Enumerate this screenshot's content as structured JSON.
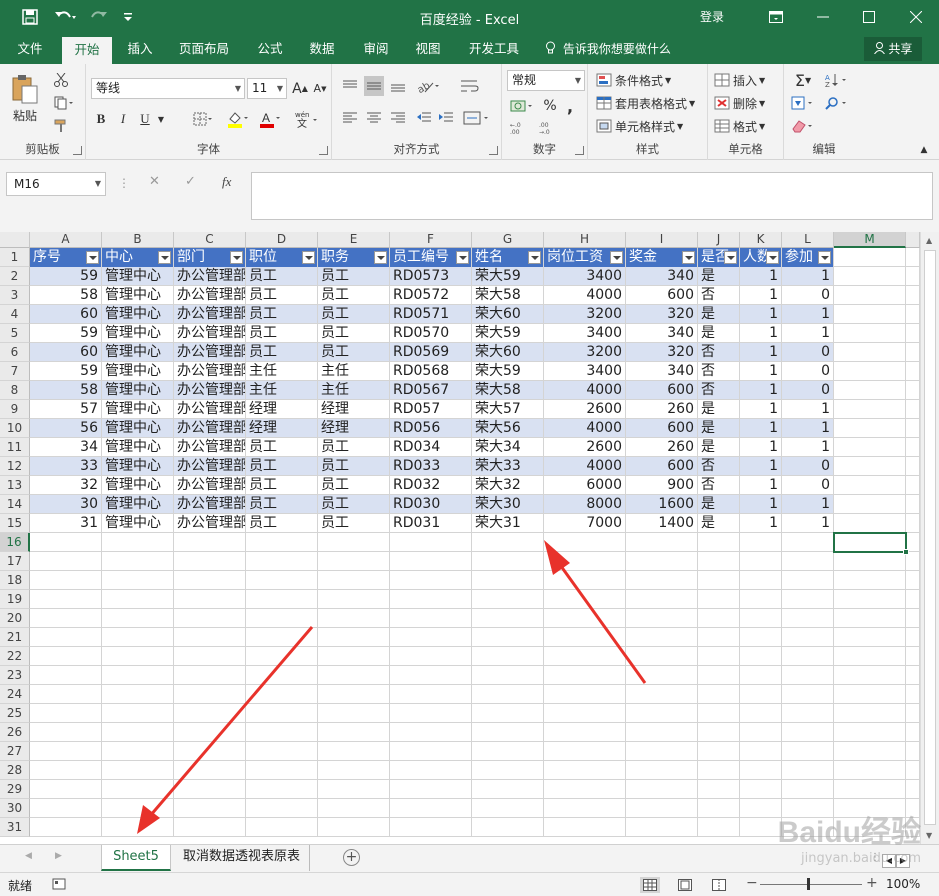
{
  "window": {
    "title": "百度经验 - Excel",
    "login": "登录",
    "accent": "#217346"
  },
  "tabs": [
    "文件",
    "开始",
    "插入",
    "页面布局",
    "公式",
    "数据",
    "审阅",
    "视图",
    "开发工具"
  ],
  "active_tab": "开始",
  "tell_me": "告诉我你想要做什么",
  "share": "共享",
  "ribbon": {
    "paste": "粘贴",
    "clipboard": "剪贴板",
    "font_name": "等线",
    "font_size": "11",
    "font_group": "字体",
    "bold": "B",
    "italic": "I",
    "underline": "U",
    "align_group": "对齐方式",
    "number_format": "常规",
    "number_group": "数字",
    "percent": "%",
    "comma": ",",
    "cond_format": "条件格式",
    "table_format": "套用表格格式",
    "cell_style": "单元格样式",
    "style_group": "样式",
    "insert": "插入",
    "delete": "删除",
    "format": "格式",
    "cells_group": "单元格",
    "edit_group": "编辑"
  },
  "formula_bar": {
    "name_box": "M16",
    "fx": "fx",
    "value": ""
  },
  "columns": [
    "A",
    "B",
    "C",
    "D",
    "E",
    "F",
    "G",
    "H",
    "I",
    "J",
    "K",
    "L",
    "M"
  ],
  "selected_column": "M",
  "table_headers": [
    "序号",
    "中心",
    "部门",
    "职位",
    "职务",
    "员工编号",
    "姓名",
    "岗位工资",
    "奖金",
    "是否",
    "人数",
    "参加"
  ],
  "rows": [
    [
      "59",
      "管理中心",
      "办公管理部",
      "员工",
      "员工",
      "RD0573",
      "荣大59",
      "3400",
      "340",
      "是",
      "1",
      "1"
    ],
    [
      "58",
      "管理中心",
      "办公管理部",
      "员工",
      "员工",
      "RD0572",
      "荣大58",
      "4000",
      "600",
      "否",
      "1",
      "0"
    ],
    [
      "60",
      "管理中心",
      "办公管理部",
      "员工",
      "员工",
      "RD0571",
      "荣大60",
      "3200",
      "320",
      "是",
      "1",
      "1"
    ],
    [
      "59",
      "管理中心",
      "办公管理部",
      "员工",
      "员工",
      "RD0570",
      "荣大59",
      "3400",
      "340",
      "是",
      "1",
      "1"
    ],
    [
      "60",
      "管理中心",
      "办公管理部",
      "员工",
      "员工",
      "RD0569",
      "荣大60",
      "3200",
      "320",
      "否",
      "1",
      "0"
    ],
    [
      "59",
      "管理中心",
      "办公管理部",
      "主任",
      "主任",
      "RD0568",
      "荣大59",
      "3400",
      "340",
      "否",
      "1",
      "0"
    ],
    [
      "58",
      "管理中心",
      "办公管理部",
      "主任",
      "主任",
      "RD0567",
      "荣大58",
      "4000",
      "600",
      "否",
      "1",
      "0"
    ],
    [
      "57",
      "管理中心",
      "办公管理部",
      "经理",
      "经理",
      "RD057",
      "荣大57",
      "2600",
      "260",
      "是",
      "1",
      "1"
    ],
    [
      "56",
      "管理中心",
      "办公管理部",
      "经理",
      "经理",
      "RD056",
      "荣大56",
      "4000",
      "600",
      "是",
      "1",
      "1"
    ],
    [
      "34",
      "管理中心",
      "办公管理部",
      "员工",
      "员工",
      "RD034",
      "荣大34",
      "2600",
      "260",
      "是",
      "1",
      "1"
    ],
    [
      "33",
      "管理中心",
      "办公管理部",
      "员工",
      "员工",
      "RD033",
      "荣大33",
      "4000",
      "600",
      "否",
      "1",
      "0"
    ],
    [
      "32",
      "管理中心",
      "办公管理部",
      "员工",
      "员工",
      "RD032",
      "荣大32",
      "6000",
      "900",
      "否",
      "1",
      "0"
    ],
    [
      "30",
      "管理中心",
      "办公管理部",
      "员工",
      "员工",
      "RD030",
      "荣大30",
      "8000",
      "1600",
      "是",
      "1",
      "1"
    ],
    [
      "31",
      "管理中心",
      "办公管理部",
      "员工",
      "员工",
      "RD031",
      "荣大31",
      "7000",
      "1400",
      "是",
      "1",
      "1"
    ]
  ],
  "row_numbers": [
    "1",
    "2",
    "3",
    "4",
    "5",
    "6",
    "7",
    "8",
    "9",
    "10",
    "11",
    "12",
    "13",
    "14",
    "15",
    "16",
    "17",
    "18",
    "19",
    "20",
    "21",
    "22",
    "23",
    "24",
    "25",
    "26",
    "27",
    "28",
    "29",
    "30",
    "31"
  ],
  "selected_row": "16",
  "sheets": [
    "Sheet5",
    "取消数据透视表原表"
  ],
  "active_sheet": "Sheet5",
  "status": {
    "ready": "就绪",
    "zoom": "100%"
  },
  "watermark": {
    "brand": "Baidu经验",
    "url": "jingyan.baidu.com"
  },
  "colors": {
    "header_fill": "#4472c4",
    "band_fill": "#d9e1f2",
    "arrow": "#e8322b"
  }
}
